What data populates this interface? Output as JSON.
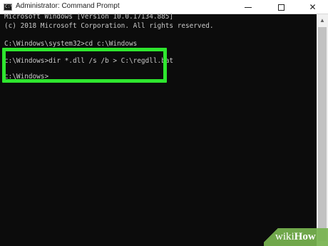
{
  "window": {
    "title": "Administrator: Command Prompt",
    "app_icon_text": "C:\\",
    "minimize_label": "",
    "maximize_label": "",
    "close_label": "✕"
  },
  "console": {
    "lines": [
      "Microsoft Windows [Version 10.0.17134.885]",
      "(c) 2018 Microsoft Corporation. All rights reserved.",
      "C:\\Windows\\system32>cd c:\\Windows",
      "c:\\Windows>dir *.dll /s /b > C:\\regdll.bat",
      "c:\\Windows>"
    ]
  },
  "watermark": {
    "prefix": "wiki",
    "suffix": "How"
  },
  "colors": {
    "highlight": "#2ee62e",
    "console_bg": "#0c0c0c",
    "console_text": "#c8c8c8"
  }
}
